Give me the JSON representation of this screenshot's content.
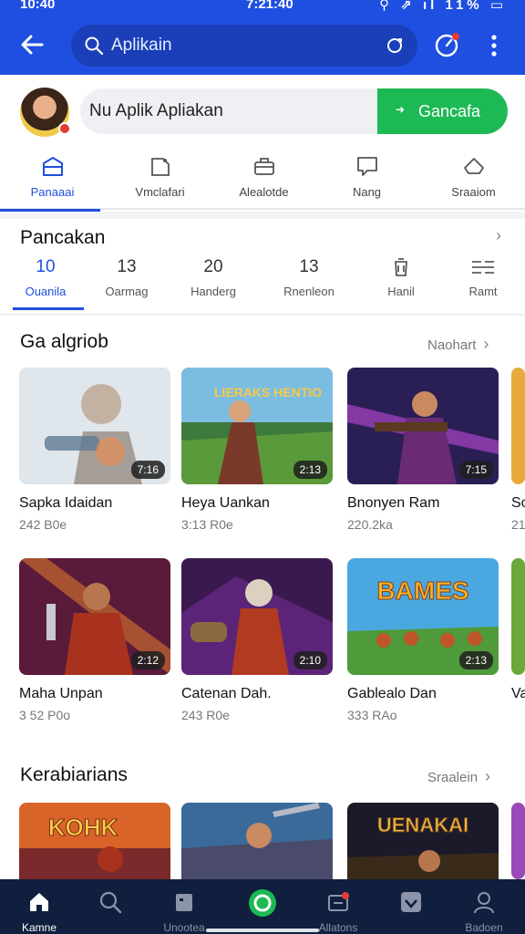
{
  "status_bar": {
    "time_left": "10:40",
    "time_center": "7:21:40",
    "icons_right": "⚲ ⇗ ıl 11% ▭"
  },
  "app_bar": {
    "search_placeholder": "Aplikain",
    "icons": [
      "back-arrow-icon",
      "search-icon",
      "scan-icon",
      "notification-icon",
      "more-icon"
    ]
  },
  "profile_search": {
    "query": "Nu Aplik Apliakan",
    "button_label": "Gancafa"
  },
  "category_tabs": [
    {
      "label": "Panaaai",
      "icon": "store-icon",
      "active": true
    },
    {
      "label": "Vmclafari",
      "icon": "folder-icon",
      "active": false
    },
    {
      "label": "Alealotde",
      "icon": "briefcase-icon",
      "active": false
    },
    {
      "label": "Nang",
      "icon": "chat-icon",
      "active": false
    },
    {
      "label": "Sraaiom",
      "icon": "home-icon",
      "active": false
    }
  ],
  "pancakan": {
    "title": "Pancakan",
    "stats": [
      {
        "num": "10",
        "label": "Ouanila",
        "active": true
      },
      {
        "num": "13",
        "label": "Oarmag",
        "active": false
      },
      {
        "num": "20",
        "label": "Handerg",
        "active": false
      },
      {
        "num": "13",
        "label": "Rnenleon",
        "active": false
      },
      {
        "num": "",
        "label": "Hanil",
        "icon": "trash-icon",
        "active": false
      },
      {
        "num": "",
        "label": "Ramt",
        "icon": "list-icon",
        "active": false
      }
    ]
  },
  "games_section": {
    "title": "Ga algriob",
    "link": "Naohart",
    "games": [
      {
        "name": "Sapka Idaidan",
        "size": "242 B0e",
        "duration": "7:16"
      },
      {
        "name": "Heya Uankan",
        "size": "3:13 R0e",
        "duration": "2:13"
      },
      {
        "name": "Bnonyen Ram",
        "size": "220.2ka",
        "duration": "7:15"
      },
      {
        "name": "Sc",
        "size": "21"
      },
      {
        "name": "Maha Unpan",
        "size": "3 52 P0o",
        "duration": "2:12"
      },
      {
        "name": "Catenan Dah.",
        "size": "243 R0e",
        "duration": "2:10"
      },
      {
        "name": "Gablealo Dan",
        "size": "333 RAo",
        "duration": "2:13"
      },
      {
        "name": "Va",
        "size": ""
      }
    ]
  },
  "kerabiarians": {
    "title": "Kerabiarians",
    "link": "Sraalein"
  },
  "banner_texts": {
    "t2": "LIERAKS HENTIO",
    "t7": "BAMES",
    "k1": "KOHK",
    "k3": "UENAKAI"
  },
  "bottom_nav": [
    {
      "label": "Kamne",
      "icon": "home-icon",
      "active": true
    },
    {
      "label": "",
      "icon": "search-icon",
      "active": false
    },
    {
      "label": "Unootea",
      "icon": "box-icon",
      "active": false
    },
    {
      "label": "",
      "icon": "green-circle-icon",
      "active": false
    },
    {
      "label": "Allatons",
      "icon": "apps-icon",
      "active": false
    },
    {
      "label": "",
      "icon": "shield-icon",
      "active": false
    },
    {
      "label": "Badoen",
      "icon": "profile-icon",
      "active": false
    }
  ],
  "colors": {
    "primary": "#1f4fe0",
    "green": "#1db954",
    "nav_bg": "#0f1f3d"
  }
}
